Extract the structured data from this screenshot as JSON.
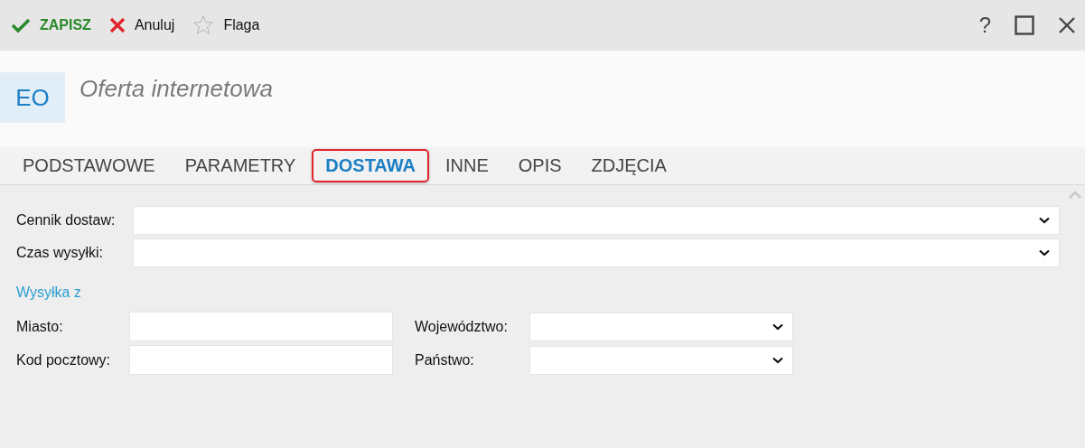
{
  "toolbar": [
    {
      "kind": "save",
      "label": "ZAPISZ"
    },
    {
      "kind": "cancel",
      "label": "Anuluj"
    },
    {
      "kind": "flag",
      "label": "Flaga"
    }
  ],
  "window_controls": {
    "help": "?"
  },
  "header": {
    "badge": "EO",
    "title": "Oferta internetowa"
  },
  "tabs": [
    {
      "label": "PODSTAWOWE",
      "selected": false
    },
    {
      "label": "PARAMETRY",
      "selected": false
    },
    {
      "label": "DOSTAWA",
      "selected": true
    },
    {
      "label": "INNE",
      "selected": false
    },
    {
      "label": "OPIS",
      "selected": false
    },
    {
      "label": "ZDJĘCIA",
      "selected": false
    }
  ],
  "fields": [
    {
      "label": "Cennik dostaw:",
      "kind": "select"
    },
    {
      "label": "Czas wysyłki:",
      "kind": "select"
    }
  ],
  "section": {
    "title": "Wysyłka z",
    "rows": [
      [
        {
          "label": "Miasto:",
          "kind": "text"
        },
        {
          "label": "Województwo:",
          "kind": "select"
        }
      ],
      [
        {
          "label": "Kod pocztowy:",
          "kind": "text"
        },
        {
          "label": "Państwo:",
          "kind": "select"
        }
      ]
    ]
  }
}
